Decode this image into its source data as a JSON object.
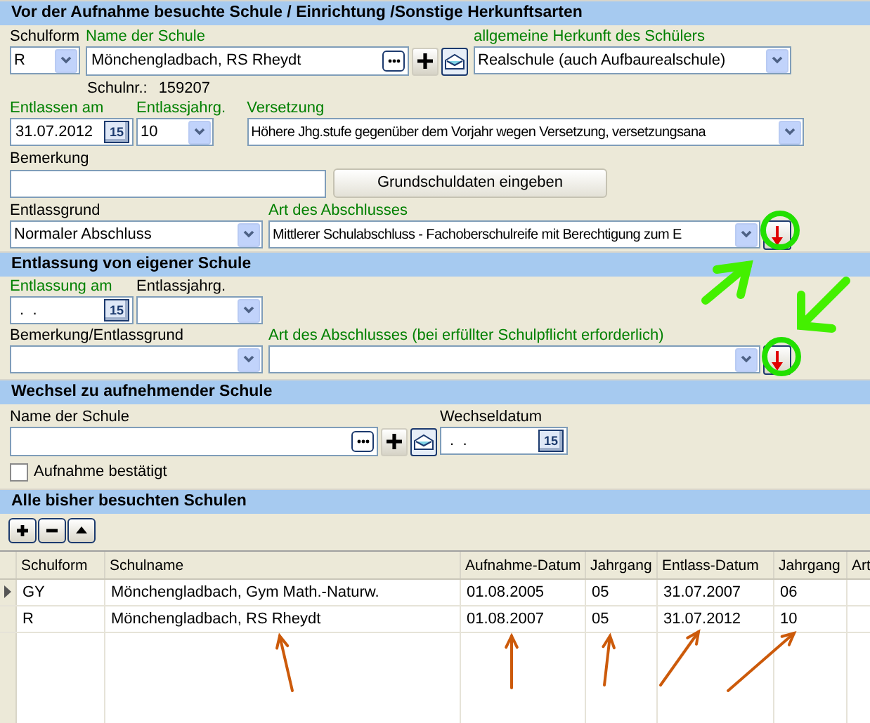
{
  "calendar_labels": [
    "15",
    "15",
    "15"
  ],
  "previous_school": {
    "title": "Vor der Aufnahme besuchte Schule / Einrichtung /Sonstige Herkunftsarten",
    "school_form": {
      "label": "Schulform",
      "required": false,
      "value": "R"
    },
    "school_name": {
      "label": "Name der Schule",
      "required": true,
      "value": "Mönchengladbach, RS Rheydt"
    },
    "origin": {
      "label": "allgemeine Herkunft des Schülers",
      "required": true,
      "value": "Realschule (auch Aufbaurealschule)"
    },
    "school_number": {
      "label": "Schulnr.:",
      "value": "159207"
    },
    "discharged_on": {
      "label": "Entlassen am",
      "required": true,
      "value": "31.07.2012"
    },
    "discharge_grade": {
      "label": "Entlassjahrg.",
      "required": true,
      "value": "10"
    },
    "promotion": {
      "label": "Versetzung",
      "required": true,
      "value": "Höhere Jhg.stufe gegenüber dem Vorjahr wegen Versetzung, versetzungsana"
    },
    "remark": {
      "label": "Bemerkung",
      "required": false
    },
    "primary_button": "Grundschuldaten eingeben",
    "discharge_reason": {
      "label": "Entlassgrund",
      "required": false,
      "value": "Normaler Abschluss"
    },
    "qualification": {
      "label": "Art des Abschlusses",
      "required": true,
      "value": "Mittlerer Schulabschluss - Fachoberschulreife mit Berechtigung zum E"
    }
  },
  "own_school": {
    "title": "Entlassung von eigener Schule",
    "discharged_on": {
      "label": "Entlassung am",
      "required": true,
      "value": " .  ."
    },
    "discharge_grade": {
      "label": "Entlassjahrg.",
      "required": false
    },
    "remark_reason": {
      "label": "Bemerkung/Entlassgrund",
      "required": false
    },
    "qualification": {
      "label": "Art des Abschlusses (bei erfüllter Schulpflicht erforderlich)",
      "required": true
    }
  },
  "transfer": {
    "title": "Wechsel zu aufnehmender Schule",
    "school_name": {
      "label": "Name der Schule",
      "required": false
    },
    "change_date": {
      "label": "Wechseldatum",
      "required": false,
      "value": " .  ."
    },
    "confirmed": {
      "label": "Aufnahme bestätigt",
      "checked": false
    }
  },
  "history": {
    "title": "Alle bisher besuchten Schulen",
    "columns": [
      "Schulform",
      "Schulname",
      "Aufnahme-Datum",
      "Jahrgang",
      "Entlass-Datum",
      "Jahrgang",
      "Art"
    ],
    "rows": [
      {
        "selected": true,
        "cells": [
          "GY",
          "Mönchengladbach, Gym Math.-Naturw.",
          "01.08.2005",
          "05",
          "31.07.2007",
          "06",
          ""
        ]
      },
      {
        "selected": false,
        "cells": [
          "R",
          "Mönchengladbach, RS Rheydt",
          "01.08.2007",
          "05",
          "31.07.2012",
          "10",
          ""
        ]
      }
    ]
  }
}
